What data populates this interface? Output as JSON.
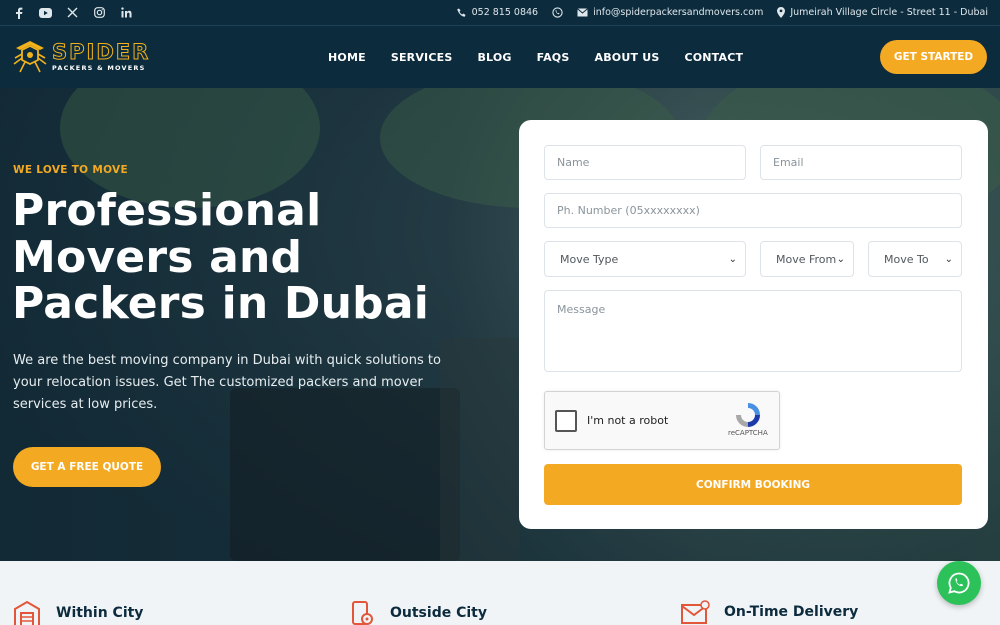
{
  "topbar": {
    "social": [
      "facebook-icon",
      "youtube-icon",
      "x-icon",
      "instagram-icon",
      "linkedin-icon"
    ],
    "phone": "052 815 0846",
    "email": "info@spiderpackersandmovers.com",
    "address": "Jumeirah Village Circle - Street 11 - Dubai"
  },
  "logo": {
    "name": "SPIDER",
    "sub": "PACKERS & MOVERS"
  },
  "nav": {
    "items": [
      "HOME",
      "SERVICES",
      "BLOG",
      "FAQS",
      "ABOUT US",
      "CONTACT"
    ],
    "cta": "GET STARTED"
  },
  "hero": {
    "tagline": "WE LOVE TO MOVE",
    "headline": "Professional Movers and Packers in Dubai",
    "description": "We are the best moving company in Dubai with quick solutions to your relocation issues. Get The customized packers and mover services at low prices.",
    "cta": "GET A FREE QUOTE"
  },
  "form": {
    "name_placeholder": "Name",
    "email_placeholder": "Email",
    "phone_placeholder": "Ph. Number (05xxxxxxxx)",
    "move_type": "Move Type",
    "move_from": "Move From",
    "move_to": "Move To",
    "message_placeholder": "Message",
    "recaptcha_label": "I'm not a robot",
    "recaptcha_brand": "reCAPTCHA",
    "submit": "CONFIRM BOOKING"
  },
  "features": [
    {
      "label": "Within City",
      "icon": "building-icon"
    },
    {
      "label": "Outside City",
      "icon": "map-pin-icon"
    },
    {
      "label": "On-Time Delivery",
      "icon": "envelope-icon"
    }
  ],
  "colors": {
    "accent": "#f4a922",
    "dark": "#0c2b3c",
    "whatsapp": "#2dc15a"
  }
}
